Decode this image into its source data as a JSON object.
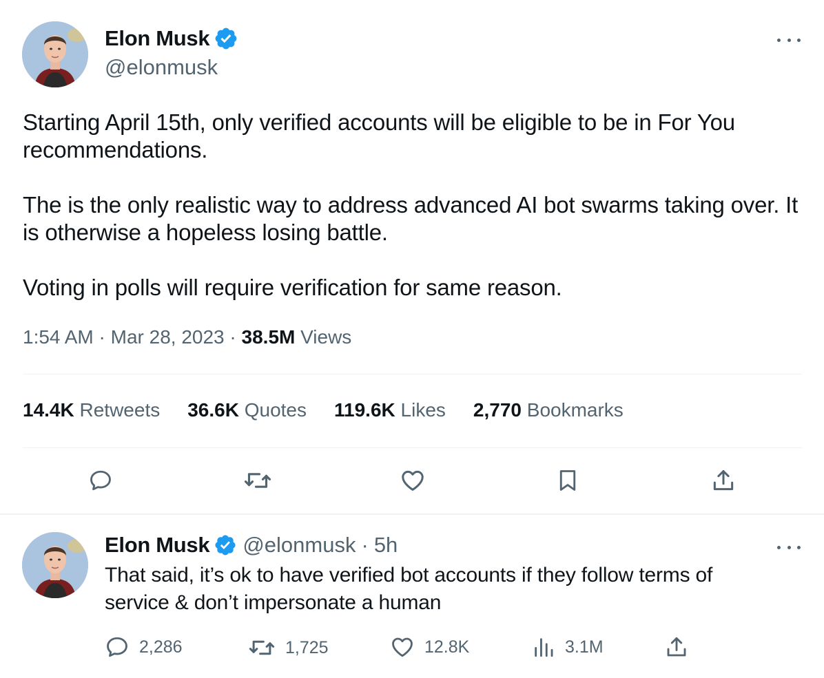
{
  "main_tweet": {
    "author": {
      "name": "Elon Musk",
      "handle": "@elonmusk"
    },
    "text": "Starting April 15th, only verified accounts will be eligible to be in For You recommendations.\n\nThe is the only realistic way to address advanced AI bot swarms taking over. It is otherwise a hopeless losing battle.\n\nVoting in polls will require verification for same reason.",
    "time": "1:54 AM",
    "date": "Mar 28, 2023",
    "views_count": "38.5M",
    "views_label": "Views",
    "stats": [
      {
        "value": "14.4K",
        "label": "Retweets"
      },
      {
        "value": "36.6K",
        "label": "Quotes"
      },
      {
        "value": "119.6K",
        "label": "Likes"
      },
      {
        "value": "2,770",
        "label": "Bookmarks"
      }
    ],
    "actions": [
      "reply-icon",
      "retweet-icon",
      "like-icon",
      "bookmark-icon",
      "share-icon"
    ]
  },
  "reply_tweet": {
    "author": {
      "name": "Elon Musk",
      "handle": "@elonmusk"
    },
    "age": "5h",
    "text": "That said, it’s ok to have verified bot accounts if they follow terms of\nservice & don’t impersonate a human",
    "counts": {
      "replies": "2,286",
      "retweets": "1,725",
      "likes": "12.8K",
      "views": "3.1M"
    }
  },
  "colors": {
    "verified": "#1d9bf0",
    "secondary_text": "#536471",
    "primary_text": "#0f1419",
    "divider": "#eff3f4"
  }
}
